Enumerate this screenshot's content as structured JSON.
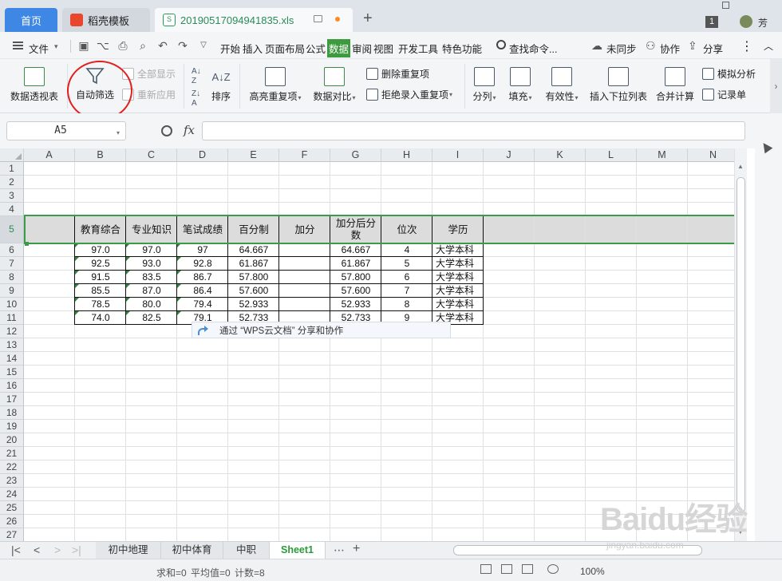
{
  "tabs": {
    "home": "首页",
    "daoke": "稻壳模板",
    "file": "20190517094941835.xls",
    "file_icon": "S",
    "new_tab": "+"
  },
  "window": {
    "badge": "1",
    "user": "芳"
  },
  "menu": {
    "file": "文件",
    "file_arrow": "▾",
    "items": [
      "开始",
      "插入",
      "页面布局",
      "公式",
      "数据",
      "审阅",
      "视图",
      "开发工具",
      "特色功能"
    ],
    "search": "查找命令...",
    "sync": "未同步",
    "coop": "协作",
    "share": "分享",
    "more": "⋮",
    "collapse": "︿"
  },
  "ribbon": {
    "pivot": "数据透视表",
    "autofilter": "自动筛选",
    "show_all": "全部显示",
    "reapply": "重新应用",
    "sort_az": "A↓Z",
    "sort": "排序",
    "highlight_dup": "高亮重复项",
    "compare": "数据对比",
    "remove_dup": "删除重复项",
    "reject_dup": "拒绝录入重复项",
    "split": "分列",
    "fill": "填充",
    "validity": "有效性",
    "dropdown": "插入下拉列表",
    "consolidate": "合并计算",
    "simulate": "模拟分析",
    "record": "记录单",
    "dd": "▾",
    "scroll": "›"
  },
  "formula_bar": {
    "cell_ref": "A5",
    "fx": "fx",
    "arrow": "▾"
  },
  "columns": [
    "A",
    "B",
    "C",
    "D",
    "E",
    "F",
    "G",
    "H",
    "I",
    "J",
    "K",
    "L",
    "M",
    "N"
  ],
  "rows": [
    "1",
    "2",
    "3",
    "4",
    "5",
    "6",
    "7",
    "8",
    "9",
    "10",
    "11",
    "12",
    "13",
    "14",
    "15",
    "16",
    "17",
    "18",
    "19",
    "20",
    "21",
    "22",
    "23",
    "24",
    "25",
    "26",
    "27"
  ],
  "table": {
    "headers": [
      "教育综合",
      "专业知识",
      "笔试成绩",
      "百分制",
      "加分",
      "加分后分数",
      "位次",
      "学历"
    ],
    "rows": [
      [
        "97.0",
        "97.0",
        "97",
        "64.667",
        "",
        "64.667",
        "4",
        "大学本科"
      ],
      [
        "92.5",
        "93.0",
        "92.8",
        "61.867",
        "",
        "61.867",
        "5",
        "大学本科"
      ],
      [
        "91.5",
        "83.5",
        "86.7",
        "57.800",
        "",
        "57.800",
        "6",
        "大学本科"
      ],
      [
        "85.5",
        "87.0",
        "86.4",
        "57.600",
        "",
        "57.600",
        "7",
        "大学本科"
      ],
      [
        "78.5",
        "80.0",
        "79.4",
        "52.933",
        "",
        "52.933",
        "8",
        "大学本科"
      ],
      [
        "74.0",
        "82.5",
        "79.1",
        "52.733",
        "",
        "52.733",
        "9",
        "大学本科"
      ]
    ]
  },
  "share_bubble": "通过 “WPS云文档” 分享和协作",
  "sheets": [
    "初中地理",
    "初中体育",
    "中职",
    "Sheet1"
  ],
  "sheet_nav": {
    "first": "|<",
    "prev": "<",
    "next": ">",
    "last": ">|",
    "more": "⋯",
    "add": "+"
  },
  "status": {
    "text": "求和=0  平均值=0  计数=8",
    "zoom": "100%"
  },
  "watermark": {
    "logo": "Baidu经验",
    "url": "jingyan.baidu.com"
  },
  "colors": {
    "accent": "#3d9a3f",
    "tab_home": "#3e87e4",
    "circle": "#e21f1f"
  }
}
